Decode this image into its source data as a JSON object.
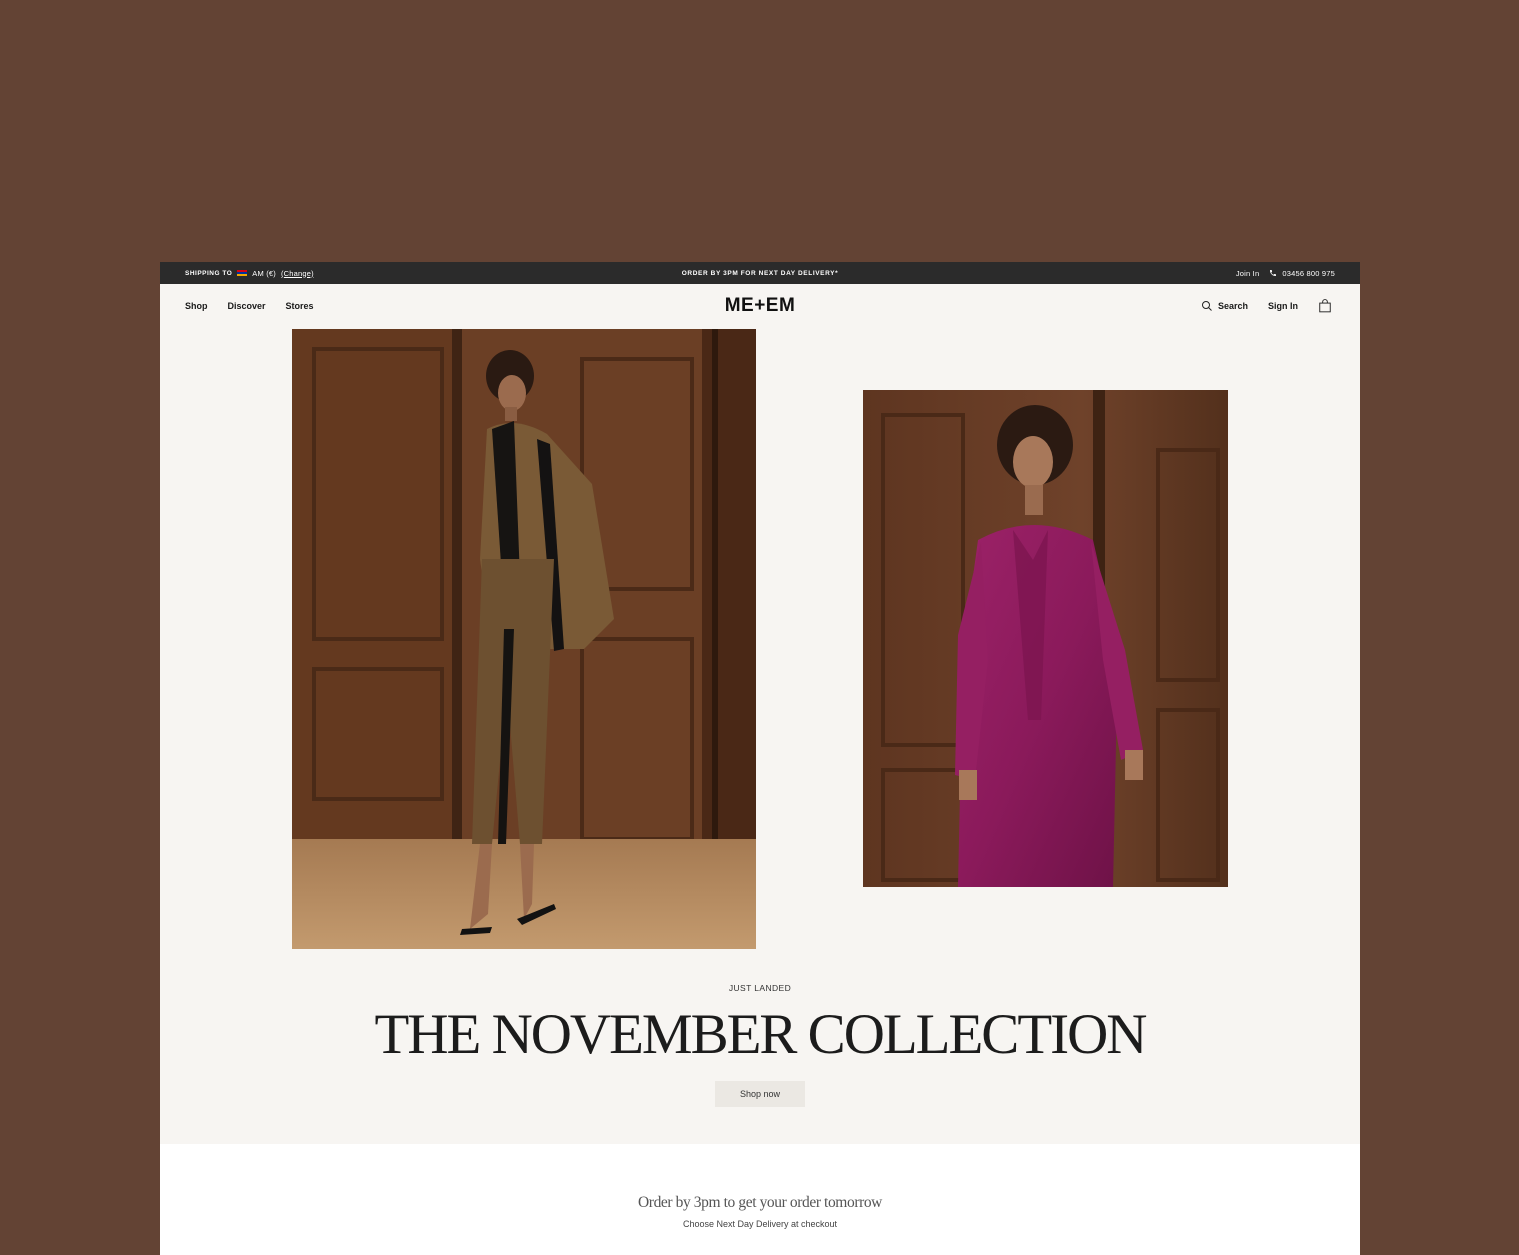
{
  "topbar": {
    "shipping_label": "SHIPPING TO",
    "region": "AM (€)",
    "change_label": "(Change)",
    "promo": "ORDER BY 3PM FOR NEXT DAY DELIVERY*",
    "join": "Join In",
    "phone": "03456 800 975"
  },
  "nav": {
    "links": [
      "Shop",
      "Discover",
      "Stores"
    ],
    "logo": "ME+EM",
    "search": "Search",
    "sign_in": "Sign In"
  },
  "hero": {
    "eyebrow": "JUST LANDED",
    "headline": "THE NOVEMBER COLLECTION",
    "cta": "Shop now"
  },
  "delivery": {
    "title": "Order by 3pm to get your order tomorrow",
    "subtitle": "Choose Next Day Delivery at checkout"
  },
  "colors": {
    "background": "#634334",
    "page": "#f7f5f2",
    "topbar": "#2b2b2b",
    "blouse": "#8b1a5b"
  }
}
